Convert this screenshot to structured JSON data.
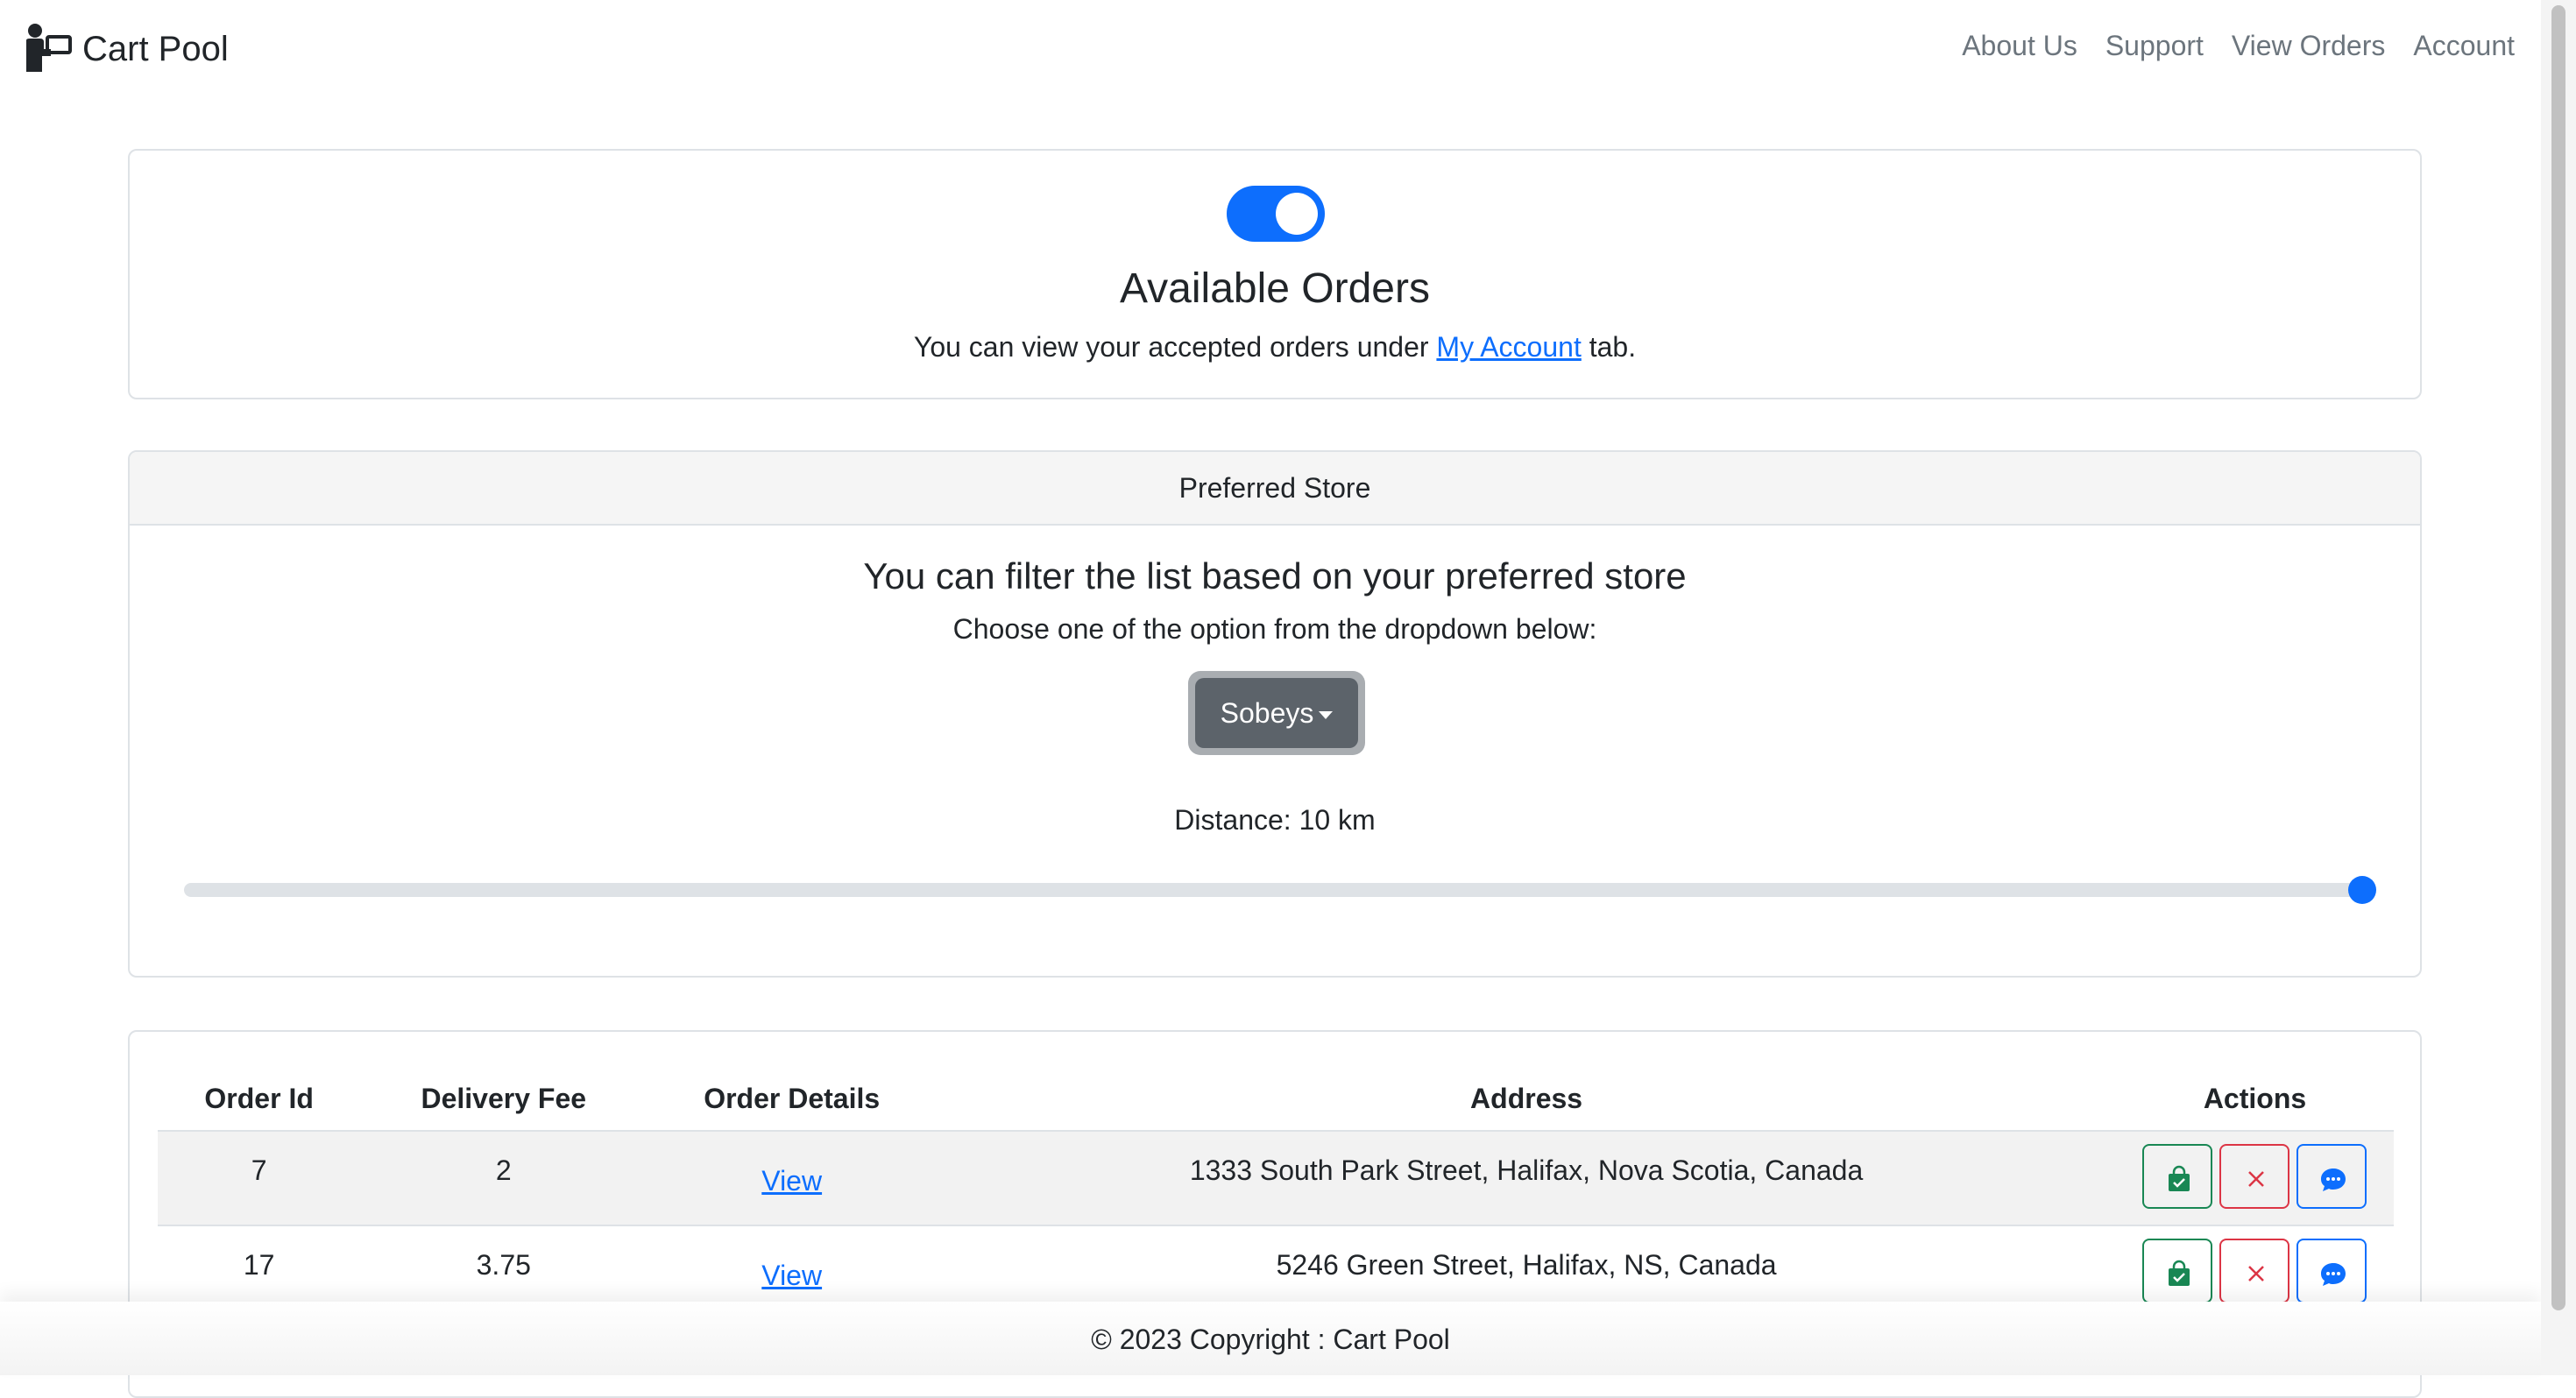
{
  "nav": {
    "brand": "Cart Pool",
    "links": [
      "About Us",
      "Support",
      "View Orders",
      "Account"
    ]
  },
  "status": {
    "toggle_on": true,
    "title": "Available Orders",
    "desc_prefix": "You can view your accepted orders under ",
    "link": "My Account",
    "desc_suffix": " tab."
  },
  "filter": {
    "header": "Preferred Store",
    "heading": "You can filter the list based on your preferred store",
    "choose": "Choose one of the option from the dropdown below:",
    "store": "Sobeys",
    "distance_label": "Distance: 10 km",
    "slider_fraction": 1.0
  },
  "table": {
    "headers": [
      "Order Id",
      "Delivery Fee",
      "Order Details",
      "Address",
      "Actions"
    ],
    "rows": [
      {
        "id": "7",
        "fee": "2",
        "details": "View",
        "address": "1333 South Park Street, Halifax, Nova Scotia, Canada"
      },
      {
        "id": "17",
        "fee": "3.75",
        "details": "View",
        "address": "5246 Green Street, Halifax, NS, Canada"
      }
    ]
  },
  "footer": {
    "text": "© 2023 Copyright : Cart Pool"
  },
  "colors": {
    "primary": "#0d6efd",
    "success": "#198754",
    "danger": "#dc3545",
    "secondary": "#5c636a"
  }
}
